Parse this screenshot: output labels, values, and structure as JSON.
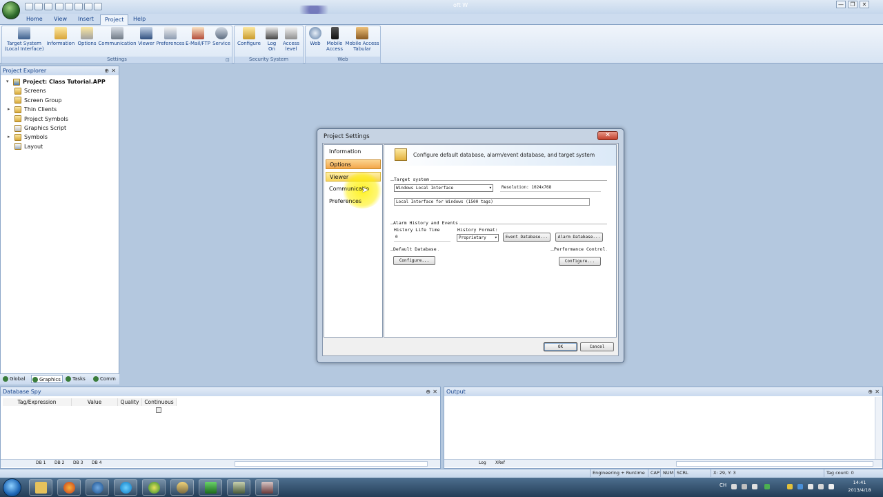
{
  "window": {
    "title_fragment": "oft W",
    "controls": [
      "—",
      "❐",
      "✕"
    ]
  },
  "ribbon": {
    "tabs": [
      "Home",
      "View",
      "Insert",
      "Project",
      "Help"
    ],
    "active_tab": "Project",
    "groups": [
      {
        "label": "Settings",
        "buttons": [
          "Target System\n(Local Interface)",
          "Information",
          "Options",
          "Communication",
          "Viewer",
          "Preferences",
          "E-Mail/FTP",
          "Service"
        ]
      },
      {
        "label": "Security System",
        "buttons": [
          "Configure",
          "Log\nOn",
          "Access\nlevel"
        ]
      },
      {
        "label": "Web",
        "buttons": [
          "Web",
          "Mobile\nAccess",
          "Mobile Access\nTabular"
        ]
      }
    ]
  },
  "explorer": {
    "title": "Project Explorer",
    "pin": "⊕",
    "close": "✕",
    "tree": [
      {
        "label": "Project: Class Tutorial.APP",
        "root": true
      },
      {
        "label": "Screens"
      },
      {
        "label": "Screen Group"
      },
      {
        "label": "Thin Clients",
        "expandable": true
      },
      {
        "label": "Project Symbols"
      },
      {
        "label": "Graphics Script"
      },
      {
        "label": "Symbols",
        "expandable": true
      },
      {
        "label": "Layout"
      }
    ],
    "bottom_tabs": [
      "Global",
      "Graphics",
      "Tasks",
      "Comm"
    ],
    "active_bottom_tab": "Graphics"
  },
  "dialog": {
    "title": "Project Settings",
    "close": "✕",
    "nav": [
      "Information",
      "Options",
      "Viewer",
      "Communicatio",
      "Preferences"
    ],
    "selected": "Options",
    "hovered": "Viewer",
    "header": "Configure default database, alarm/event database, and target system",
    "target_system": {
      "label": "Target system",
      "combo": "Windows Local Interface",
      "resolution": "Resolution: 1024x768",
      "description": "Local Interface for Windows (1500 tags)"
    },
    "alarm": {
      "label": "Alarm History and Events",
      "life_label": "History Life Time",
      "life_value": "0",
      "format_label": "History Format:",
      "format_value": "Proprietary",
      "event_db": "Event Database...",
      "alarm_db": "Alarm Database..."
    },
    "default_db": {
      "label": "Default Database",
      "button": "Configure..."
    },
    "performance": {
      "label": "Performance Control",
      "button": "Configure..."
    },
    "ok": "OK",
    "cancel": "Cancel"
  },
  "dbspy": {
    "title": "Database Spy",
    "columns": [
      "Tag/Expression",
      "Value",
      "Quality",
      "Continuous"
    ],
    "sheets": [
      "DB 1",
      "DB 2",
      "DB 3",
      "DB 4"
    ]
  },
  "output": {
    "title": "Output",
    "tabs": [
      "Log",
      "XRef"
    ]
  },
  "status": {
    "mode": "Engineering + Runtime",
    "caps": "CAP",
    "num": "NUM",
    "scrl": "SCRL",
    "coords": "X: 29, Y: 3",
    "tag_count": "Tag count: 0"
  },
  "taskbar": {
    "lang": "CH",
    "time": "14:41",
    "date": "2013/4/18"
  }
}
